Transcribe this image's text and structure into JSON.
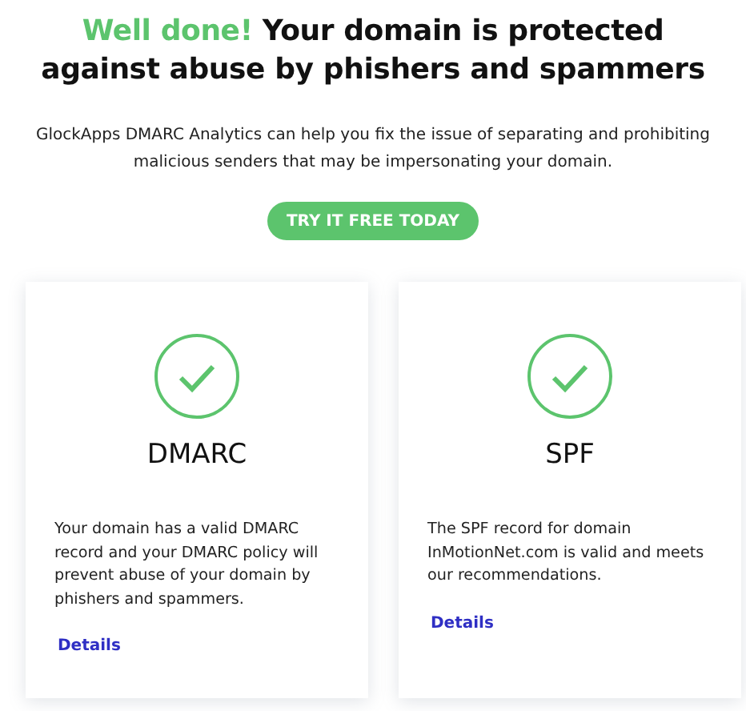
{
  "heading": {
    "highlight": "Well done!",
    "text": "Your domain is protected against abuse by phishers and spammers"
  },
  "intro": "GlockApps DMARC Analytics can help you fix the issue of separating and prohibiting malicious senders that may be impersonating your domain.",
  "cta_button": "TRY IT FREE TODAY",
  "cards": [
    {
      "title": "DMARC",
      "passed": true,
      "description": "Your domain has a valid DMARC record and your DMARC policy will prevent abuse of your domain by phishers and spammers.",
      "link": "Details"
    },
    {
      "title": "SPF",
      "passed": true,
      "description": "The SPF record for domain InMotionNet.com is valid and meets our recommendations.",
      "link": "Details"
    }
  ]
}
